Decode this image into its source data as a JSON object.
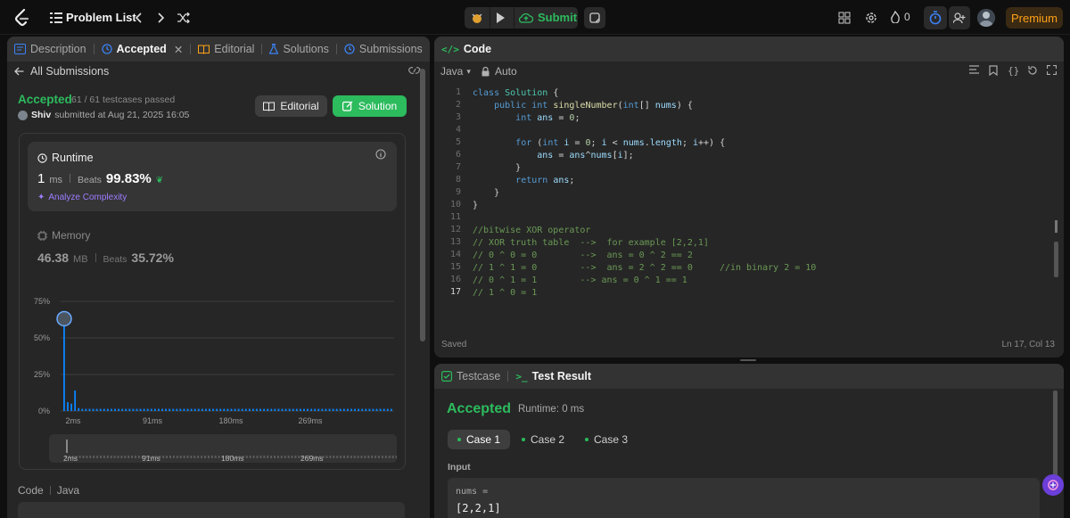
{
  "topbar": {
    "problem_list": "Problem List",
    "submit_label": "Submit",
    "streak_count": "0",
    "premium_label": "Premium"
  },
  "left": {
    "tabs": [
      {
        "label": "Description"
      },
      {
        "label": "Accepted"
      },
      {
        "label": "Editorial"
      },
      {
        "label": "Solutions"
      },
      {
        "label": "Submissions"
      }
    ],
    "back_label": "All Submissions",
    "status": "Accepted",
    "testcases": "61 / 61 testcases passed",
    "user": "Shiv",
    "submitted_text": "submitted at Aug 21, 2025 16:05",
    "editorial_btn": "Editorial",
    "solution_btn": "Solution",
    "runtime": {
      "title": "Runtime",
      "value": "1",
      "unit": "ms",
      "beats_label": "Beats",
      "beats_value": "99.83%",
      "analyze": "Analyze Complexity"
    },
    "memory": {
      "title": "Memory",
      "value": "46.38",
      "unit": "MB",
      "beats_label": "Beats",
      "beats_value": "35.72%"
    },
    "code_label": "Code",
    "code_lang": "Java"
  },
  "chart_data": {
    "type": "bar",
    "y_ticks": [
      "75%",
      "50%",
      "25%",
      "0%"
    ],
    "x_ticks": [
      "2ms",
      "91ms",
      "180ms",
      "269ms"
    ],
    "ylim": [
      0,
      75
    ],
    "highlight_index": 0,
    "values": [
      68,
      6,
      5,
      14,
      2,
      1.5,
      1.5,
      1.5,
      1.5,
      1.5,
      1.5,
      1.5,
      1.5,
      1.5,
      1.5,
      1.5,
      1.5,
      1.5,
      1.5,
      1.5,
      1.5,
      1.5,
      1.5,
      1.5,
      1.5,
      1.5,
      1.5,
      1.5,
      1.5,
      1.5,
      1.5,
      1.5,
      1.5,
      1.5,
      1.5,
      1.5,
      1.5,
      1.5,
      1.5,
      1.5,
      1.5,
      1.5,
      1.5,
      1.5,
      1.5,
      1.5,
      1.5,
      1.5,
      1.5,
      1.5,
      1.5,
      1.5,
      1.5,
      1.5,
      1.5,
      1.5,
      1.5,
      1.5,
      1.5,
      1.5,
      1.5,
      1.5,
      1.5,
      1.5,
      1.5,
      1.5,
      1.5,
      1.5,
      1.5,
      1.5,
      1.5,
      1.5,
      1.5,
      1.5,
      1.5,
      1.5,
      1.5,
      1.5,
      1.5,
      1.5,
      1.5,
      1.5,
      1.5,
      1.5,
      1.5,
      1.5,
      1.5,
      1.5,
      1.5,
      1.5,
      1.5
    ],
    "range_ticks": [
      "2ms",
      "91ms",
      "180ms",
      "269ms"
    ]
  },
  "code_panel": {
    "title": "Code",
    "lang": "Java",
    "mode": "Auto",
    "saved": "Saved",
    "cursor": "Ln 17, Col 13",
    "line_numbers": [
      "1",
      "2",
      "3",
      "4",
      "5",
      "6",
      "7",
      "8",
      "9",
      "10",
      "11",
      "12",
      "13",
      "14",
      "15",
      "16",
      "17"
    ]
  },
  "bottom": {
    "tab_testcase": "Testcase",
    "tab_result": "Test Result",
    "status": "Accepted",
    "runtime": "Runtime: 0 ms",
    "cases": [
      "Case 1",
      "Case 2",
      "Case 3"
    ],
    "input_label": "Input",
    "var_label": "nums =",
    "var_value": "[2,2,1]"
  },
  "colors": {
    "green": "#2cbb5d",
    "bar": "#0a84ff",
    "premium": "#ffa116"
  }
}
